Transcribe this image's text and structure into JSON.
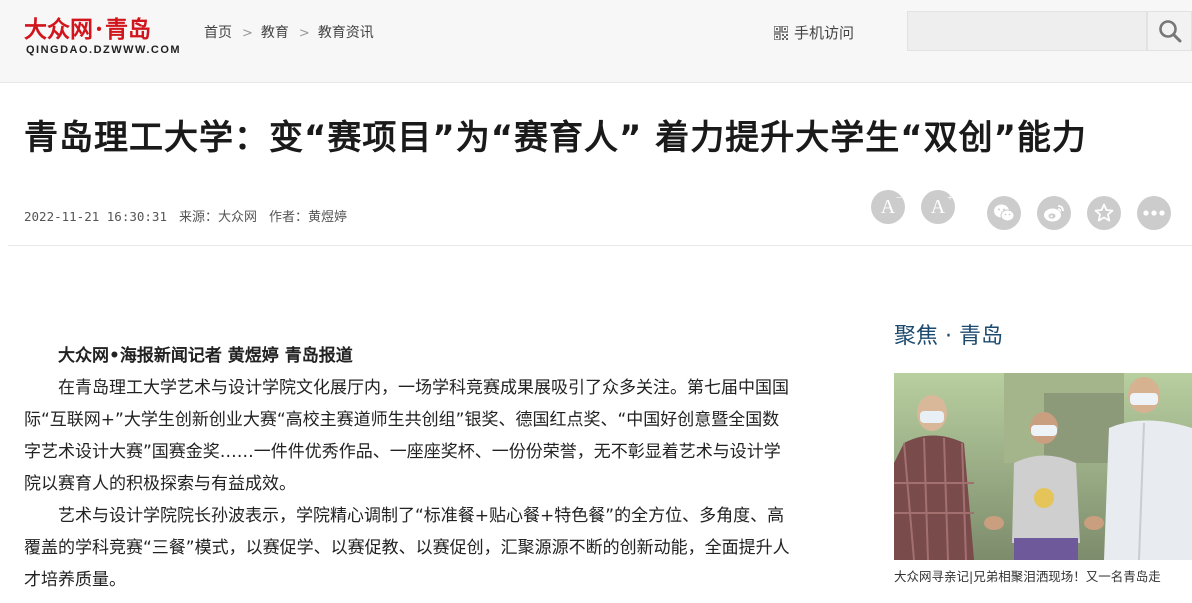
{
  "header": {
    "logo_text_main": "大众网",
    "logo_text_city": "青岛",
    "logo_domain": "QINGDAO.DZWWW.COM",
    "breadcrumb": [
      "首页",
      "教育",
      "教育资讯"
    ],
    "mobile_label": "手机访问",
    "search": {
      "value": "",
      "placeholder": ""
    }
  },
  "article": {
    "title": "青岛理工大学：变“赛项目”为“赛育人” 着力提升大学生“双创”能力",
    "date": "2022-11-21 16:30:31",
    "source": "来源：大众网",
    "author": "作者：黄煜婷",
    "byline": "大众网•海报新闻记者 黄煜婷 青岛报道",
    "paragraphs": [
      "在青岛理工大学艺术与设计学院文化展厅内，一场学科竞赛成果展吸引了众多关注。第七届中国国际“互联网+”大学生创新创业大赛“高校主赛道师生共创组”银奖、德国红点奖、“中国好创意暨全国数字艺术设计大赛”国赛金奖……一件件优秀作品、一座座奖杯、一份份荣誉，无不彰显着艺术与设计学院以赛育人的积极探索与有益成效。",
      "艺术与设计学院院长孙波表示，学院精心调制了“标准餐+贴心餐+特色餐”的全方位、多角度、高覆盖的学科竞赛“三餐”模式，以赛促学、以赛促教、以赛促创，汇聚源源不断的创新动能，全面提升人才培养质量。"
    ]
  },
  "tools": {
    "font_decrease": "A",
    "font_increase": "A",
    "icons": [
      "font-decrease-icon",
      "font-increase-icon",
      "wechat-icon",
      "weibo-icon",
      "favorite-star-icon",
      "more-icon"
    ]
  },
  "sidebar": {
    "title": "聚焦 · 青岛",
    "caption": "大众网寻亲记|兄弟相聚泪洒现场！又一名青岛走"
  },
  "colors": {
    "logo_red": "#d2141c",
    "sidebar_title": "#1c4a6e",
    "tool_bg": "#cccccc"
  }
}
